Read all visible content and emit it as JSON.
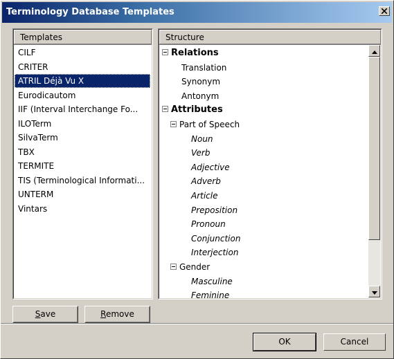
{
  "window": {
    "title": "Terminology Database Templates",
    "close_glyph": "✕"
  },
  "templates_panel": {
    "header": "Templates",
    "items": [
      {
        "label": "CILF",
        "selected": false
      },
      {
        "label": "CRITER",
        "selected": false
      },
      {
        "label": "ATRIL Déjà Vu X",
        "selected": true
      },
      {
        "label": "Eurodicautom",
        "selected": false
      },
      {
        "label": "IIF (Interval Interchange Fo...",
        "selected": false
      },
      {
        "label": "ILOTerm",
        "selected": false
      },
      {
        "label": "SilvaTerm",
        "selected": false
      },
      {
        "label": "TBX",
        "selected": false
      },
      {
        "label": "TERMITE",
        "selected": false
      },
      {
        "label": "TIS (Terminological Informati...",
        "selected": false
      },
      {
        "label": "UNTERM",
        "selected": false
      },
      {
        "label": "Vintars",
        "selected": false
      }
    ]
  },
  "structure_panel": {
    "header": "Structure",
    "rows": [
      {
        "label": "Relations",
        "level": 0,
        "style": "bold",
        "toggle": true
      },
      {
        "label": "Translation",
        "level": 1,
        "style": "normal",
        "toggle": false
      },
      {
        "label": "Synonym",
        "level": 1,
        "style": "normal",
        "toggle": false
      },
      {
        "label": "Antonym",
        "level": 1,
        "style": "normal",
        "toggle": false
      },
      {
        "label": "Attributes",
        "level": 0,
        "style": "bold",
        "toggle": true
      },
      {
        "label": "Part of Speech",
        "level": 1,
        "style": "normal",
        "toggle": true
      },
      {
        "label": "Noun",
        "level": 2,
        "style": "italic",
        "toggle": false
      },
      {
        "label": "Verb",
        "level": 2,
        "style": "italic",
        "toggle": false
      },
      {
        "label": "Adjective",
        "level": 2,
        "style": "italic",
        "toggle": false
      },
      {
        "label": "Adverb",
        "level": 2,
        "style": "italic",
        "toggle": false
      },
      {
        "label": "Article",
        "level": 2,
        "style": "italic",
        "toggle": false
      },
      {
        "label": "Preposition",
        "level": 2,
        "style": "italic",
        "toggle": false
      },
      {
        "label": "Pronoun",
        "level": 2,
        "style": "italic",
        "toggle": false
      },
      {
        "label": "Conjunction",
        "level": 2,
        "style": "italic",
        "toggle": false
      },
      {
        "label": "Interjection",
        "level": 2,
        "style": "italic",
        "toggle": false
      },
      {
        "label": "Gender",
        "level": 1,
        "style": "normal",
        "toggle": true
      },
      {
        "label": "Masculine",
        "level": 2,
        "style": "italic",
        "toggle": false
      },
      {
        "label": "Feminine",
        "level": 2,
        "style": "italic",
        "toggle": false
      }
    ],
    "scroll": {
      "thumb_start": 0.0,
      "thumb_fraction": 0.8
    }
  },
  "buttons": {
    "save": {
      "underline": "S",
      "rest": "ave"
    },
    "remove": {
      "underline": "R",
      "rest": "emove"
    },
    "ok": "OK",
    "cancel": "Cancel"
  },
  "colors": {
    "face": "#d4d0c8",
    "selection": "#0a246a",
    "title_start": "#0a246a",
    "title_end": "#a6caf0"
  }
}
